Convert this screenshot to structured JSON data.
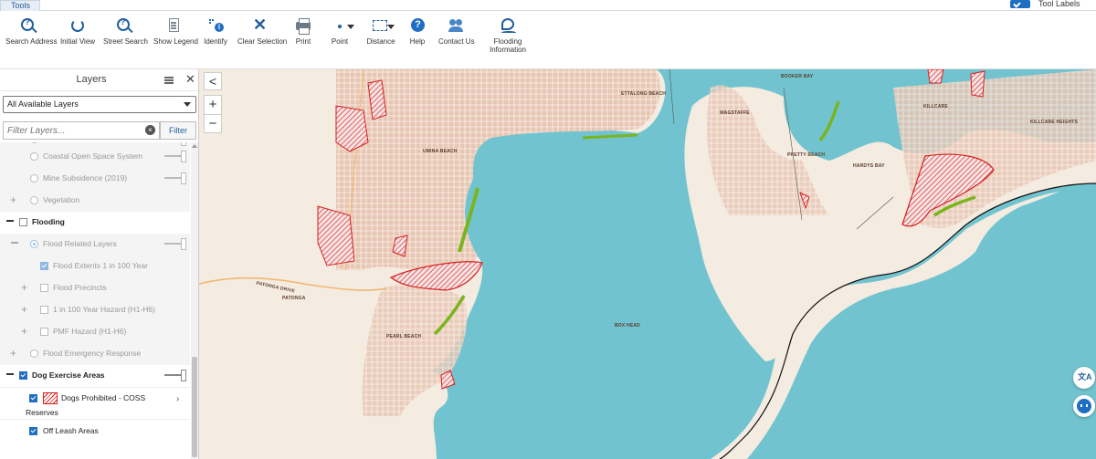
{
  "top": {
    "tab_label": "Tools",
    "tool_labels_label": "Tool Labels",
    "tool_labels_checked": true
  },
  "toolbar": {
    "search_address": "Search Address",
    "initial_view": "Initial View",
    "street_search": "Street Search",
    "show_legend": "Show Legend",
    "identify": "Identify",
    "clear_selection": "Clear Selection",
    "print": "Print",
    "point": "Point",
    "distance": "Distance",
    "help": "Help",
    "contact_us": "Contact Us",
    "flooding_info_line1": "Flooding",
    "flooding_info_line2": "Information"
  },
  "panel": {
    "title": "Layers",
    "layer_select_value": "All Available Layers",
    "filter_placeholder": "Filter Layers...",
    "filter_button": "Filter",
    "rows": [
      {
        "label": "Coastal Open Space System"
      },
      {
        "label": "Mine Subsidence (2019)"
      },
      {
        "label": "Vegetation"
      },
      {
        "label": "Flooding"
      },
      {
        "label": "Flood Related Layers"
      },
      {
        "label": "Flood Extents 1 in 100 Year"
      },
      {
        "label": "Flood Precincts"
      },
      {
        "label": "1 in 100 Year Hazard (H1-H6)"
      },
      {
        "label": "PMF Hazard (H1-H6)"
      },
      {
        "label": "Flood Emergency Response"
      },
      {
        "label": "Dog Exercise Areas"
      },
      {
        "label": "Dogs Prohibited - COSS"
      },
      {
        "label": "Reserves"
      },
      {
        "label": "Off Leash Areas"
      }
    ]
  },
  "map": {
    "collapse_label": "<",
    "zoom_in": "+",
    "zoom_out": "−",
    "translate_label": "文A",
    "labels": {
      "booker_bay": "BOOKER BAY",
      "ettalong_beach": "ETTALONG BEACH",
      "killcare": "KILLCARE",
      "killcare_heights": "KILLCARE HEIGHTS",
      "wagstaffe": "WAGSTAFFE",
      "umina_beach": "UMINA BEACH",
      "pretty_beach": "PRETTY BEACH",
      "hardys_bay": "HARDYS BAY",
      "patonga_drive": "PATONGA DRIVE",
      "patonga": "PATONGA",
      "box_head": "BOX HEAD",
      "pearl_beach": "PEARL BEACH"
    },
    "colors": {
      "water": "#71c4cf",
      "land": "#f3e8dc",
      "urban": "#e8c9b8",
      "flood": "#d62020",
      "offleash": "#7ab51d"
    }
  }
}
